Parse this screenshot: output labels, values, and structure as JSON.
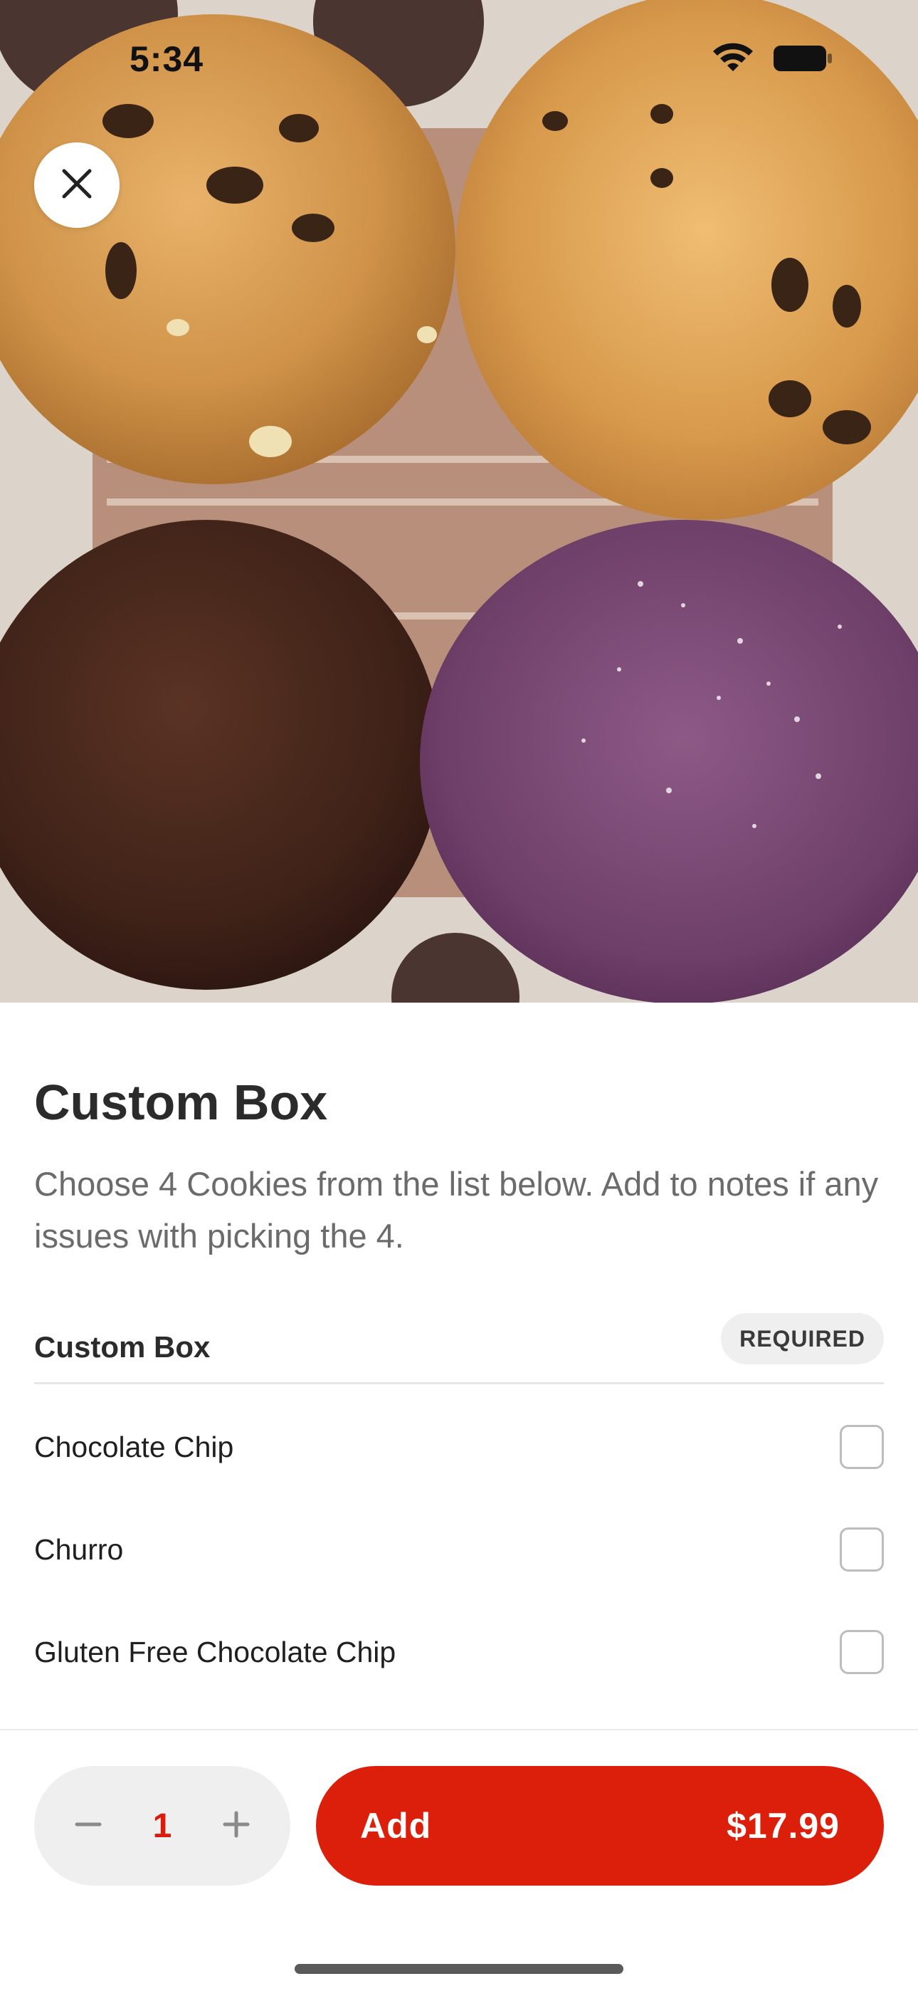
{
  "status_bar": {
    "time": "5:34",
    "icons": [
      "wifi-icon",
      "battery-icon"
    ]
  },
  "hero": {
    "image": "cookies-photo",
    "close_icon": "close-icon"
  },
  "product": {
    "title": "Custom Box",
    "description": "Choose 4 Cookies from the list below. Add to notes if any issues with picking the 4."
  },
  "options_section": {
    "title": "Custom Box",
    "badge": "REQUIRED",
    "items": [
      {
        "label": "Chocolate Chip",
        "checked": false
      },
      {
        "label": "Churro",
        "checked": false
      },
      {
        "label": "Gluten Free Chocolate Chip",
        "checked": false
      }
    ]
  },
  "footer": {
    "quantity": "1",
    "minus_icon": "minus-icon",
    "plus_icon": "plus-icon",
    "add_label": "Add",
    "price": "$17.99"
  },
  "colors": {
    "accent": "#db1f0a",
    "text_primary": "#2b2b2b",
    "text_secondary": "#6b6b6b",
    "pill_bg": "#efefef"
  }
}
